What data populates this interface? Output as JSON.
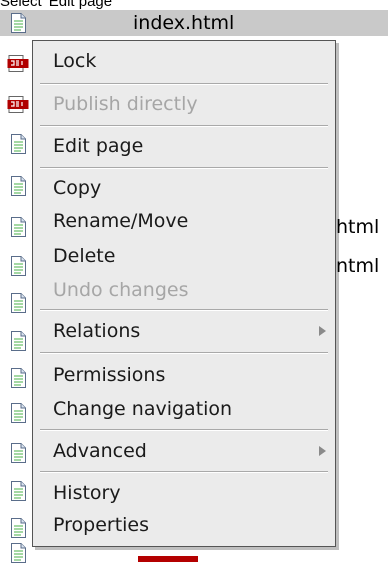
{
  "header": {
    "title": "Select 'Edit page'"
  },
  "file_list": {
    "selected_file": "index.html",
    "truncated_names": [
      "html",
      "ntml"
    ],
    "icons": [
      "page-icon",
      "js-icon",
      "js-icon",
      "page-icon",
      "page-icon",
      "page-icon",
      "page-icon",
      "page-icon",
      "page-icon",
      "page-icon",
      "page-icon",
      "page-icon",
      "page-icon",
      "page-icon",
      "page-icon",
      "page-icon",
      "page-icon",
      "page-icon",
      "page-icon",
      "page-icon",
      "page-icon"
    ]
  },
  "context_menu": {
    "lock": "Lock",
    "publish_directly": "Publish directly",
    "edit_page": "Edit page",
    "copy": "Copy",
    "rename_move": "Rename/Move",
    "delete": "Delete",
    "undo_changes": "Undo changes",
    "relations": "Relations",
    "permissions": "Permissions",
    "change_navigation": "Change navigation",
    "advanced": "Advanced",
    "history": "History",
    "properties": "Properties"
  }
}
